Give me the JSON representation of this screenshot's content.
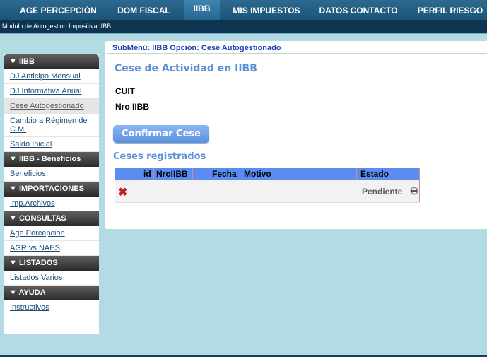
{
  "topnav": {
    "tabs": [
      {
        "label": "AGE PERCEPCIÓN"
      },
      {
        "label": "DOM FISCAL"
      },
      {
        "label": "IIBB"
      },
      {
        "label": "MIS IMPUESTOS"
      },
      {
        "label": "DATOS CONTACTO"
      },
      {
        "label": "PERFIL RIESGO"
      }
    ],
    "active": "IIBB"
  },
  "subbar": {
    "title": "Modulo de Autogestion Impositiva IIBB"
  },
  "sidebar": {
    "sections": [
      {
        "title": "▼ IIBB",
        "items": [
          "DJ Anticipo Mensual",
          "DJ Informativa Anual",
          "Cese Autogestionado",
          "Cambio a Régimen de C.M.",
          "Saldo Inicial"
        ]
      },
      {
        "title": "▼ IIBB - Beneficios",
        "items": [
          "Beneficios"
        ]
      },
      {
        "title": "▼ IMPORTACIONES",
        "items": [
          "Imp.Archivos"
        ]
      },
      {
        "title": "▼ CONSULTAS",
        "items": [
          "Age.Percepcion",
          "AGR vs NAES"
        ]
      },
      {
        "title": "▼ LISTADOS",
        "items": [
          "Listados Varios"
        ]
      },
      {
        "title": "▼ AYUDA",
        "items": [
          "Instructivos"
        ]
      }
    ],
    "selected": "Cese Autogestionado"
  },
  "main": {
    "breadcrumb": "SubMenú: IIBB Opción: Cese Autogestionado",
    "title": "Cese de Actividad en IIBB",
    "cuit_label": "CUIT",
    "nro_iibb_label": "Nro IIBB",
    "confirm_button": "Confirmar Cese",
    "ceses_title": "Ceses registrados",
    "table": {
      "headers": [
        "id",
        "NroIIBB",
        "Fecha",
        "Motivo",
        "Estado"
      ],
      "rows": [
        {
          "delete_icon": "✖",
          "estado": "Pendiente"
        }
      ]
    }
  },
  "colors": {
    "nav": "#1c5478",
    "accent_blue": "#5b8fd6",
    "table_header": "#5b8df0",
    "delete": "#c61f1f"
  },
  "icons": [
    "delete-icon",
    "print-icon"
  ]
}
